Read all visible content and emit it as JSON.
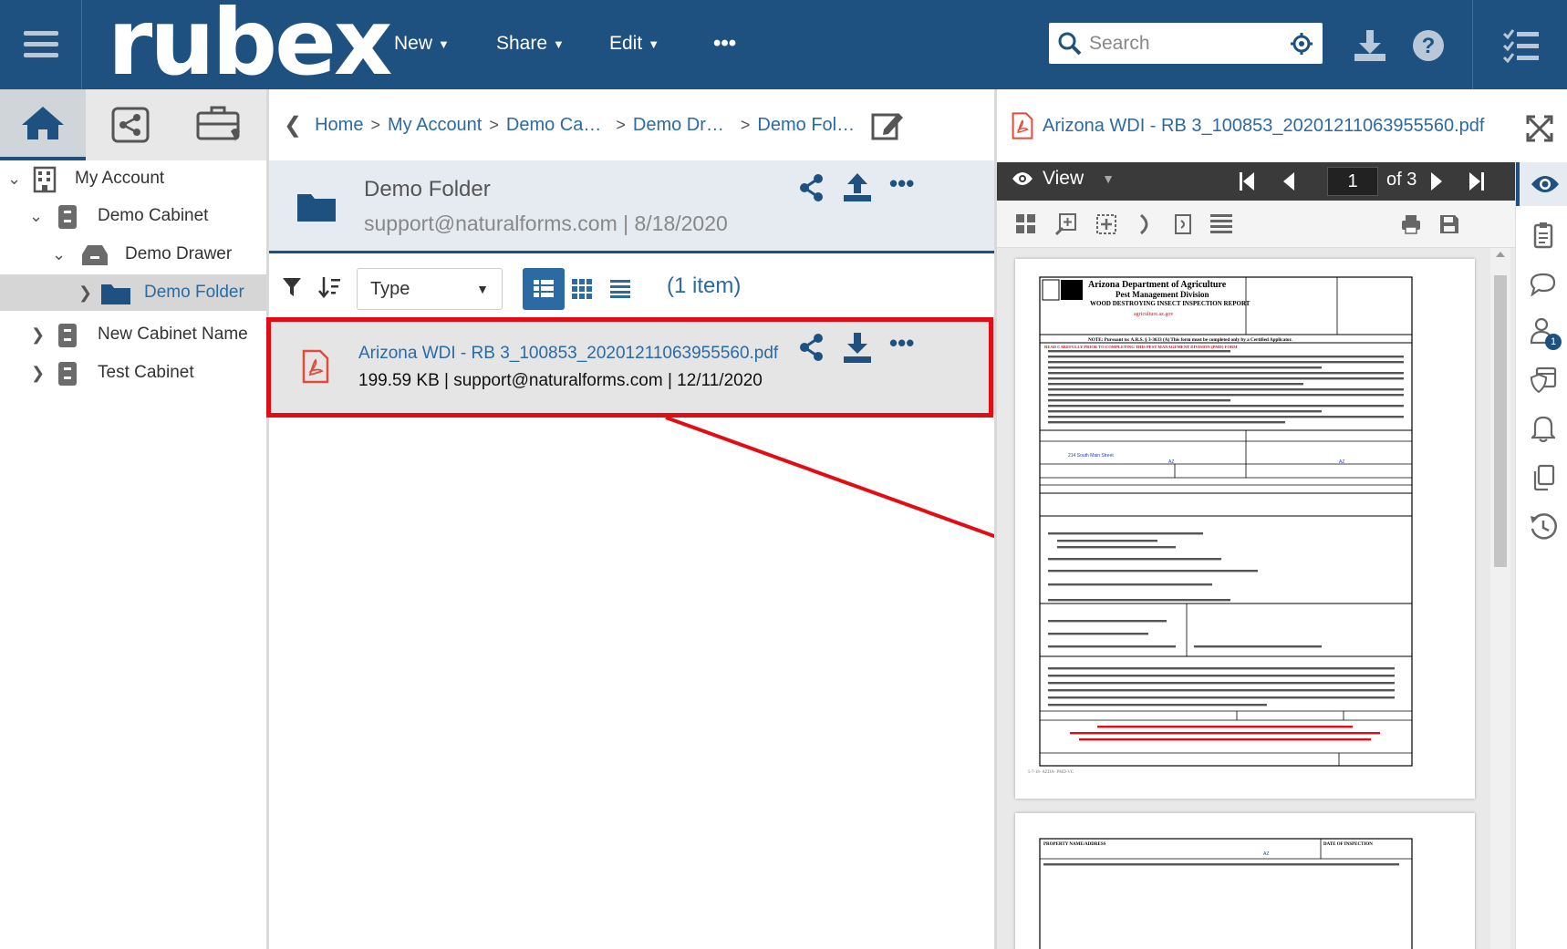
{
  "app": {
    "logo": "rubex",
    "menus": [
      {
        "label": "New"
      },
      {
        "label": "Share"
      },
      {
        "label": "Edit"
      }
    ],
    "more_label": "•••",
    "search_placeholder": "Search"
  },
  "left": {
    "tabs": [
      "home-icon",
      "share-icon",
      "briefcase-icon"
    ],
    "tree": [
      {
        "label": "My Account"
      },
      {
        "label": "Demo Cabinet"
      },
      {
        "label": "Demo Drawer"
      },
      {
        "label": "Demo Folder"
      },
      {
        "label": "New Cabinet Name"
      },
      {
        "label": "Test Cabinet"
      }
    ]
  },
  "breadcrumb": [
    "Home",
    "My Account",
    "Demo Ca…",
    "Demo Dr…",
    "Demo Fol…"
  ],
  "folder": {
    "name": "Demo Folder",
    "meta": "support@naturalforms.com | 8/18/2020"
  },
  "filter": {
    "type_label": "Type",
    "item_count": "(1 item)"
  },
  "file": {
    "name": "Arizona WDI - RB 3_100853_20201211063955560.pdf",
    "meta": "199.59 KB | support@naturalforms.com | 12/11/2020"
  },
  "preview": {
    "title": "Arizona WDI - RB 3_100853_20201211063955560.pdf",
    "view_label": "View",
    "page_number": "1",
    "page_of": "of 3",
    "rail_badge": "1",
    "doc": {
      "agency": "Arizona Department of Agriculture",
      "division": "Pest Management Division",
      "report": "WOOD DESTROYING INSECT INSPECTION REPORT",
      "site": "agriculture.az.gov",
      "note": "NOTE:  Pursuant to: A.R.S. § 3-3633 (A) This form must be completed only by a Certified Applicator.",
      "read_first": "READ CAREFULLY PRIOR TO COMPLETING THIS PEST MANAGEMENT DIVISION (PMD) FORM",
      "street": "214 South Main Street",
      "state": "AZ",
      "footer_code": "5-7-18- AZDA- PMD-VC",
      "p2_header": "PROPERTY NAME/ADDRESS",
      "p2_date": "DATE OF INSPECTION"
    }
  },
  "colors": {
    "brand": "#1e5180",
    "link": "#2c6aa3",
    "highlight": "#e30b14"
  }
}
